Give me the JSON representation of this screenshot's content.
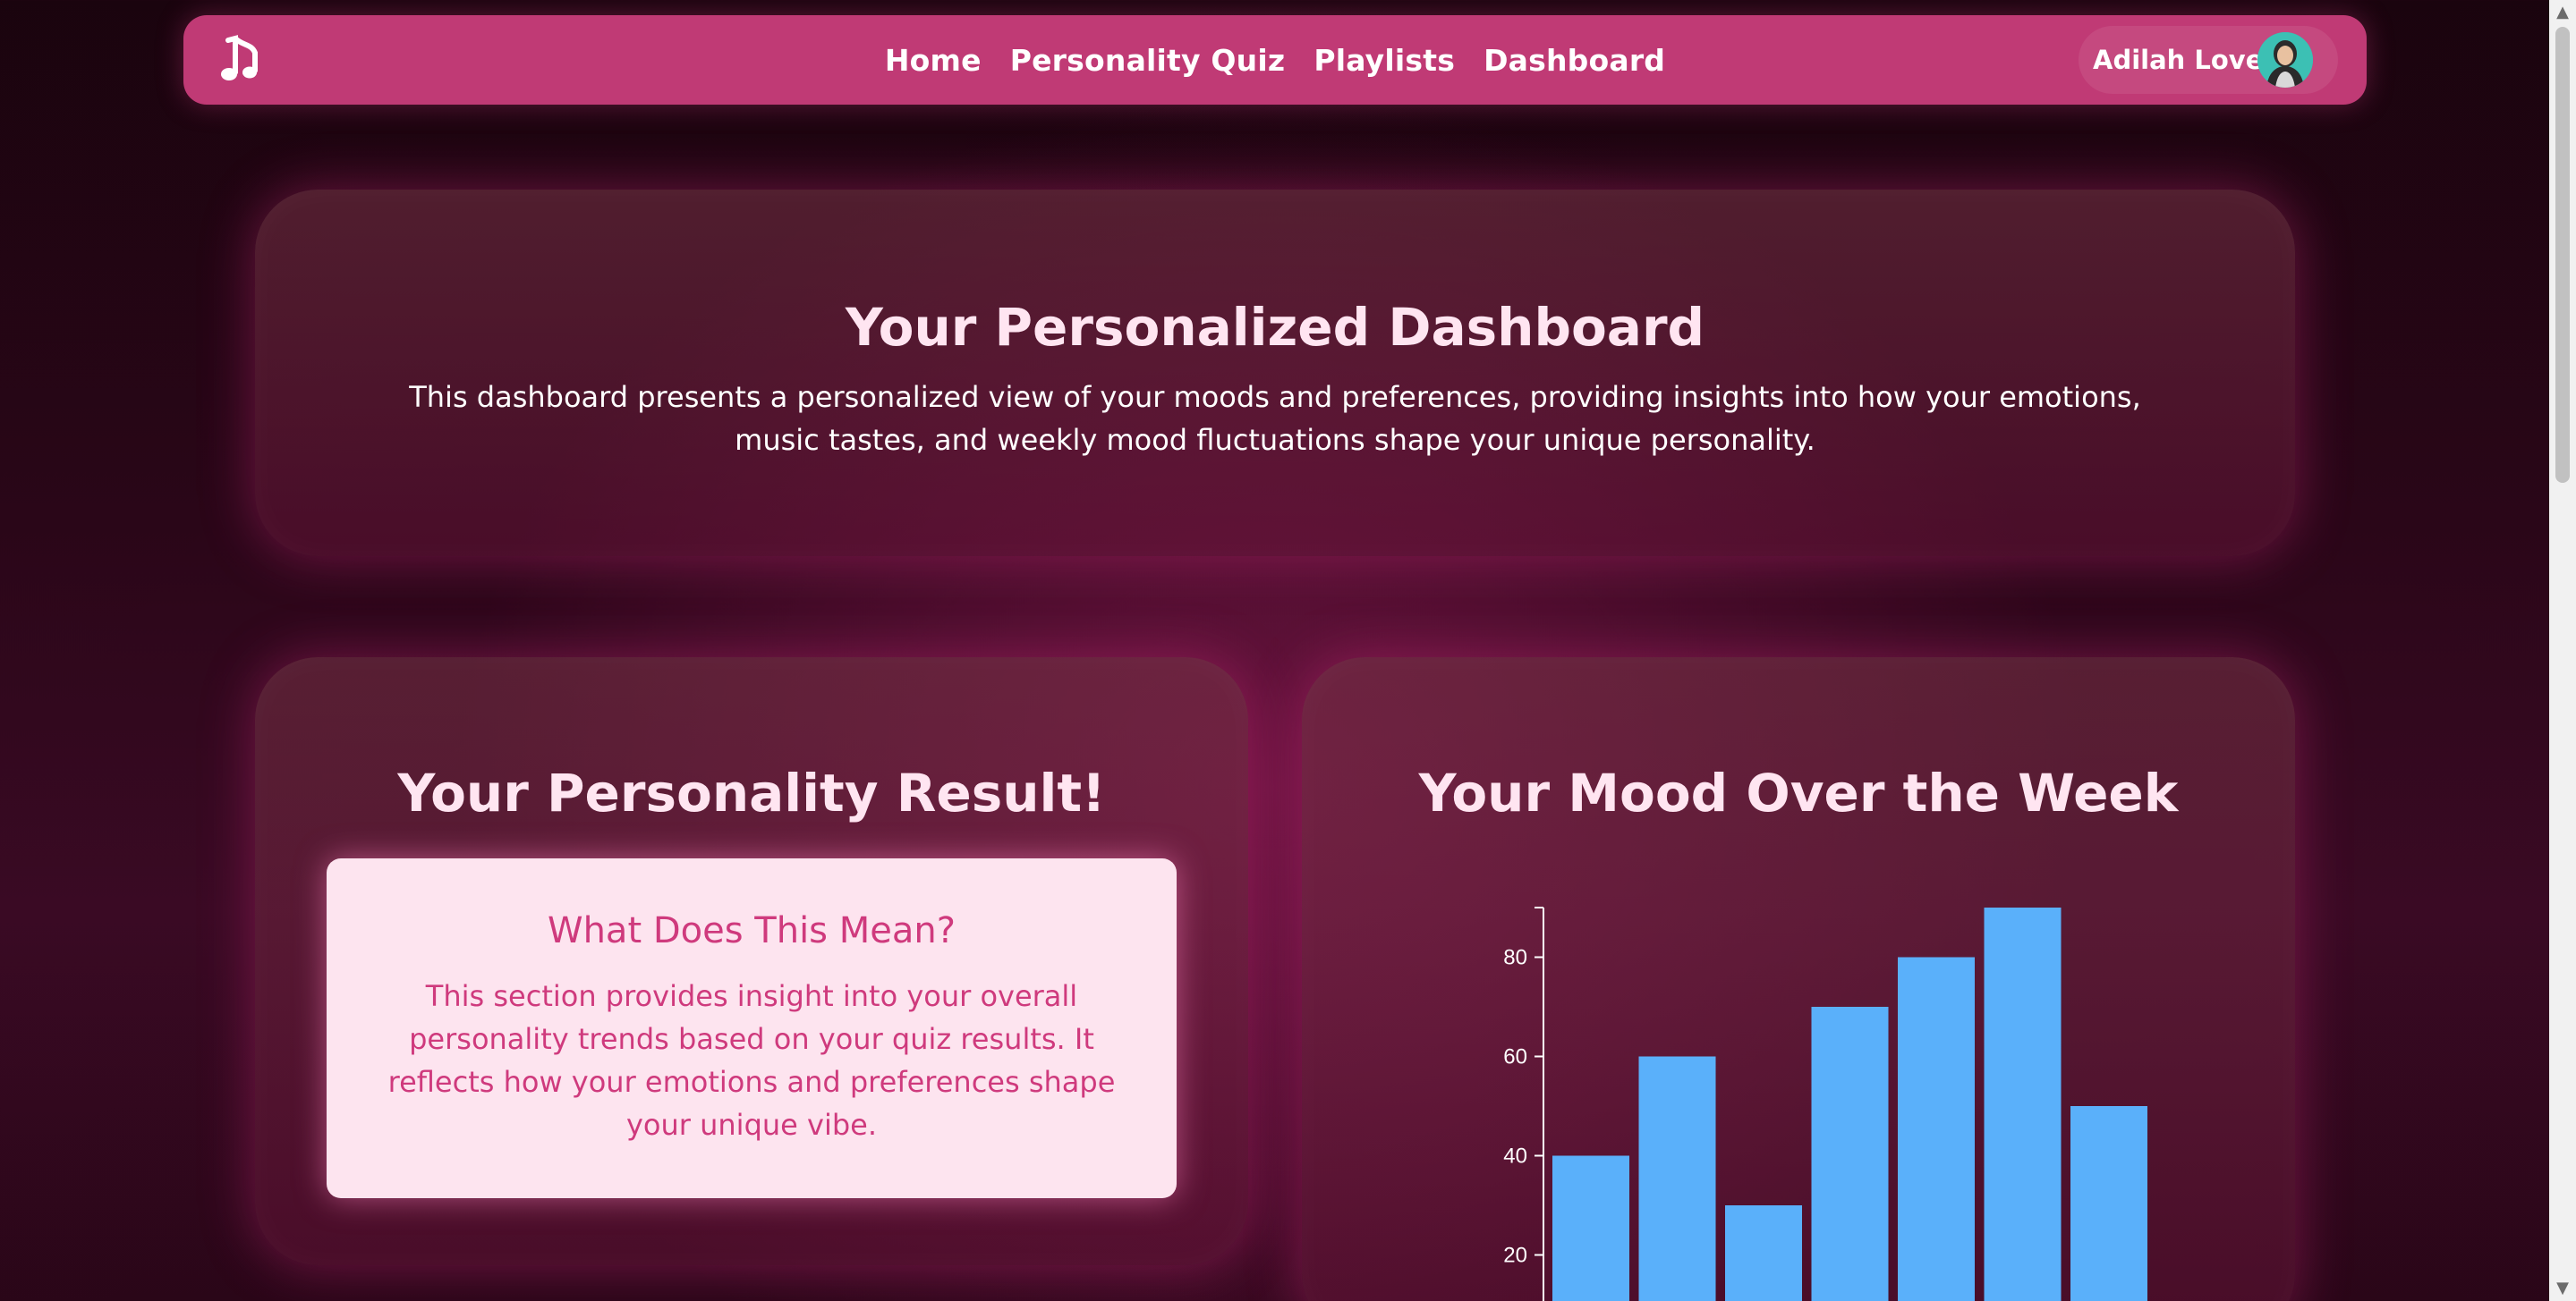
{
  "nav": {
    "logo_icon": "music-note-icon",
    "links": [
      {
        "label": "Home"
      },
      {
        "label": "Personality Quiz"
      },
      {
        "label": "Playlists"
      },
      {
        "label": "Dashboard"
      }
    ],
    "user": {
      "name": "Adilah Love",
      "avatar_icon": "user-avatar"
    }
  },
  "hero": {
    "title": "Your Personalized Dashboard",
    "description": "This dashboard presents a personalized view of your moods and preferences, providing insights into how your emotions, music tastes, and weekly mood fluctuations shape your unique personality."
  },
  "personality": {
    "title": "Your Personality Result!",
    "box_title": "What Does This Mean?",
    "box_text": "This section provides insight into your overall personality trends based on your quiz results. It reflects how your emotions and preferences shape your unique vibe."
  },
  "mood": {
    "title": "Your Mood Over the Week"
  },
  "chart_data": {
    "type": "bar",
    "values": [
      40,
      60,
      30,
      70,
      80,
      90,
      50
    ],
    "ylim": [
      0,
      90
    ],
    "yticks": [
      "80",
      "60",
      "40",
      "20"
    ],
    "bar_color": "#5ab0fa"
  },
  "colors": {
    "nav": "#c03a75",
    "accent_text": "#cf3a7d",
    "box_bg": "#fde4ef"
  }
}
